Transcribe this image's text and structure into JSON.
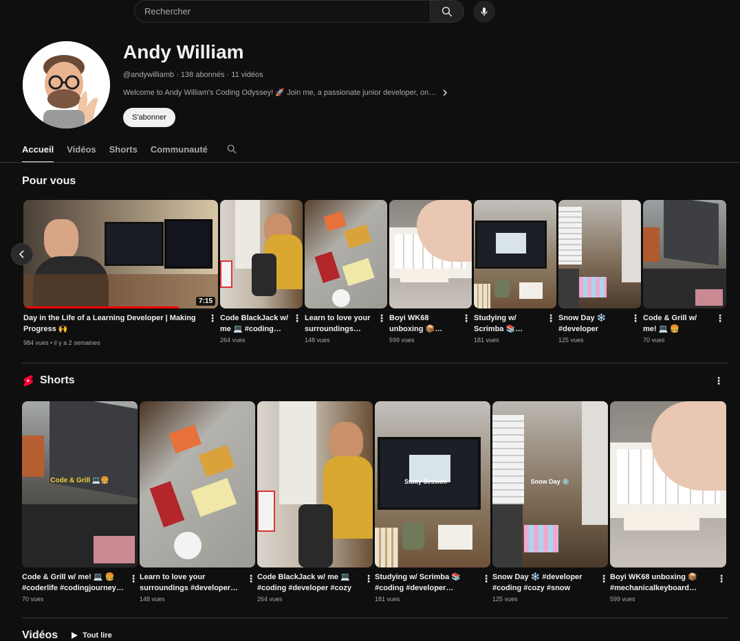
{
  "search": {
    "placeholder": "Rechercher"
  },
  "channel": {
    "name": "Andy William",
    "meta": "@andywilliamb · 138 abonnés · 11 vidéos",
    "description": "Welcome to Andy William's Coding Odyssey! 🚀 Join me, a passionate junior developer, on…",
    "subscribe_label": "S'abonner"
  },
  "tabs": [
    {
      "label": "Accueil",
      "active": true
    },
    {
      "label": "Vidéos",
      "active": false
    },
    {
      "label": "Shorts",
      "active": false
    },
    {
      "label": "Communauté",
      "active": false
    }
  ],
  "pour_vous": {
    "title": "Pour vous",
    "items": [
      {
        "title": "Day in the Life of a Learning Developer | Making Progress 🙌",
        "meta": "984 vues • il y a 2 semaines",
        "duration": "7:15",
        "progress": 0.8
      },
      {
        "title": "Code BlackJack w/ me 💻 #coding…",
        "meta": "264 vues"
      },
      {
        "title": "Learn to love your surroundings…",
        "meta": "148 vues"
      },
      {
        "title": "Boyi WK68 unboxing 📦…",
        "meta": "599 vues"
      },
      {
        "title": "Studying w/ Scrimba 📚…",
        "meta": "181 vues"
      },
      {
        "title": "Snow Day ❄️ #developer #codi…",
        "meta": "125 vues"
      },
      {
        "title": "Code & Grill w/ me! 💻 🍔 #coderlife…",
        "meta": "70 vues"
      }
    ]
  },
  "shorts": {
    "title": "Shorts",
    "items": [
      {
        "title": "Code & Grill w/ me! 💻 🍔 #coderlife #codingjourney…",
        "meta": "70 vues",
        "overlay": "Code & Grill 💻🍔"
      },
      {
        "title": "Learn to love your surroundings #developer…",
        "meta": "148 vues",
        "overlay": ""
      },
      {
        "title": "Code BlackJack w/ me 💻 #coding #developer #cozy",
        "meta": "264 vues",
        "overlay": ""
      },
      {
        "title": "Studying w/ Scrimba 📚 #coding #developer…",
        "meta": "181 vues",
        "overlay": "Study Session"
      },
      {
        "title": "Snow Day ❄️ #developer #coding #cozy #snow",
        "meta": "125 vues",
        "overlay": "Snow Day ❄️"
      },
      {
        "title": "Boyi WK68 unboxing 📦 #mechanicalkeyboard…",
        "meta": "599 vues",
        "overlay": ""
      }
    ]
  },
  "videos": {
    "title": "Vidéos",
    "play_all_label": "Tout lire"
  }
}
